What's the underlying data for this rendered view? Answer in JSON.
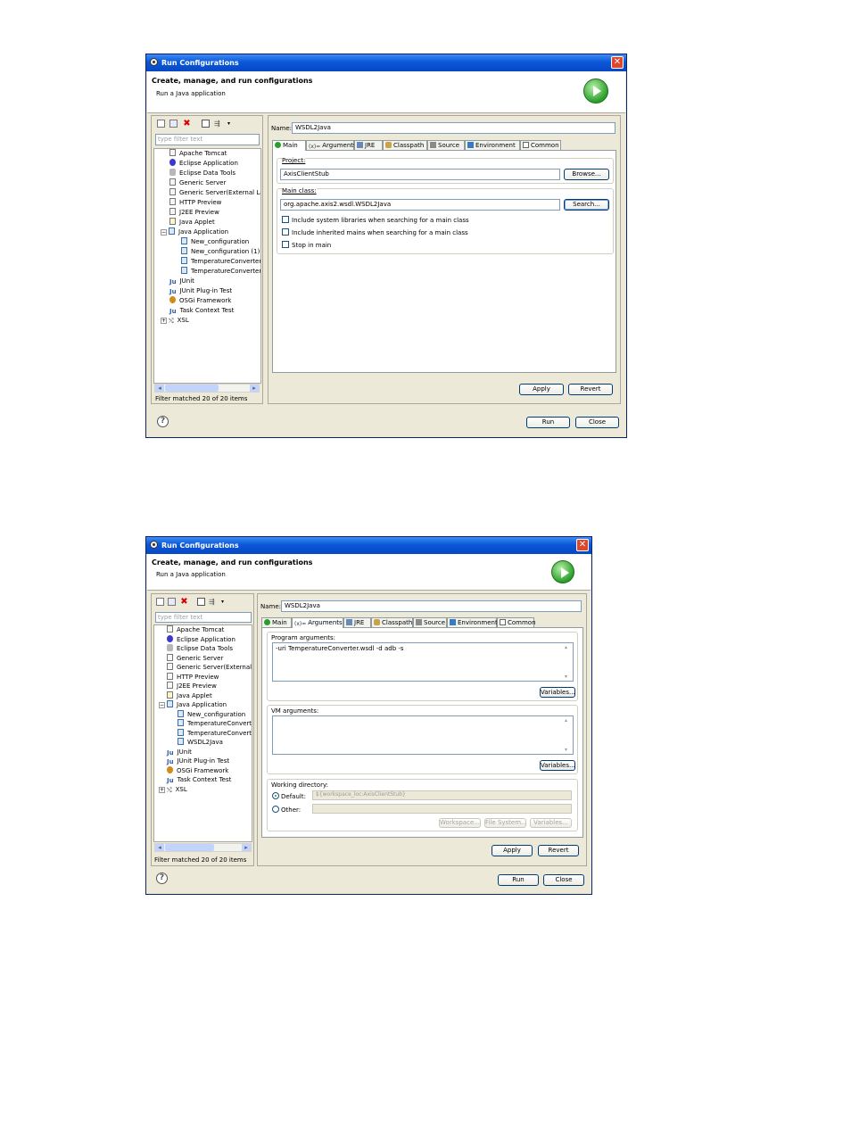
{
  "dialog": {
    "title": "Run Configurations",
    "header_title": "Create, manage, and run configurations",
    "header_subtitle": "Run a Java application",
    "close_glyph": "✕"
  },
  "toolbar": {
    "icons": [
      "new-launch-config-icon",
      "duplicate-icon",
      "delete-icon",
      "collapse-all-icon",
      "filter-icon"
    ],
    "delete_glyph": "✖",
    "filter_glyph": "⇶",
    "dropdown_glyph": "▾"
  },
  "filter": {
    "placeholder": "type filter text"
  },
  "tree1": {
    "items": [
      "Apache Tomcat",
      "Eclipse Application",
      "Eclipse Data Tools",
      "Generic Server",
      "Generic Server(External La",
      "HTTP Preview",
      "J2EE Preview",
      "Java Applet",
      "Java Application",
      "New_configuration",
      "New_configuration (1)",
      "TemperatureConverter",
      "TemperatureConverter",
      "JUnit",
      "JUnit Plug-in Test",
      "OSGi Framework",
      "Task Context Test",
      "XSL"
    ]
  },
  "tree2": {
    "items": [
      "Apache Tomcat",
      "Eclipse Application",
      "Eclipse Data Tools",
      "Generic Server",
      "Generic Server(External La",
      "HTTP Preview",
      "J2EE Preview",
      "Java Applet",
      "Java Application",
      "New_configuration",
      "TemperatureConverter",
      "TemperatureConverter",
      "WSDL2Java",
      "JUnit",
      "JUnit Plug-in Test",
      "OSGi Framework",
      "Task Context Test",
      "XSL"
    ]
  },
  "tree_glyphs": {
    "expanded": "−",
    "collapsed": "+",
    "ju": "Ju",
    "xsl": "⤭"
  },
  "filter_status": "Filter matched 20 of 20 items",
  "name_label": "Name:",
  "name_value": "WSDL2Java",
  "tabs": [
    "Main",
    "Arguments",
    "JRE",
    "Classpath",
    "Source",
    "Environment",
    "Common"
  ],
  "args_glyph": "(x)=",
  "main_tab": {
    "project_label": "Project:",
    "project_value": "AxisClientStub",
    "browse_label": "Browse...",
    "main_class_label": "Main class:",
    "main_class_value": "org.apache.axis2.wsdl.WSDL2Java",
    "search_label": "Search...",
    "check1": "Include system libraries when searching for a main class",
    "check2": "Include inherited mains when searching for a main class",
    "check3": "Stop in main"
  },
  "args_tab": {
    "program_args_label": "Program arguments:",
    "program_args_value": "-uri TemperatureConverter.wsdl -d adb -s",
    "variables_label": "Variables...",
    "vm_args_label": "VM arguments:",
    "working_dir_label": "Working directory:",
    "default_label": "Default:",
    "default_value": "${workspace_loc:AxisClientStub}",
    "other_label": "Other:",
    "workspace_label": "Workspace...",
    "filesystem_label": "File System...",
    "scroll_up": "▴",
    "scroll_down": "▾"
  },
  "buttons": {
    "apply": "Apply",
    "revert": "Revert",
    "run": "Run",
    "close": "Close",
    "help": "?"
  },
  "scroll_glyphs": {
    "left": "◂",
    "right": "▸",
    "thumb": "⋮"
  }
}
